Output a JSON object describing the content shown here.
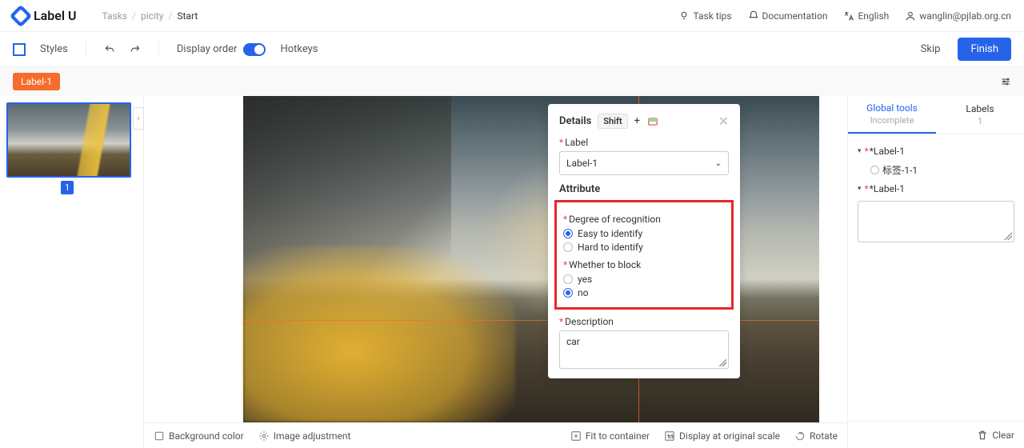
{
  "brand": "Label U",
  "breadcrumb": {
    "items": [
      "Tasks",
      "picity",
      "Start"
    ]
  },
  "header_links": {
    "tips": "Task tips",
    "docs": "Documentation",
    "lang": "English",
    "user": "wanglin@pjlab.org.cn"
  },
  "toolbar": {
    "styles": "Styles",
    "display_order": "Display order",
    "display_order_on": true,
    "hotkeys": "Hotkeys",
    "skip": "Skip",
    "finish": "Finish"
  },
  "tagbar": {
    "active_tag": "Label-1"
  },
  "thumbnails": {
    "current_index": "1"
  },
  "details": {
    "title": "Details",
    "hotkey_hint": "Shift",
    "plus": "+",
    "label_label": "Label",
    "label_value": "Label-1",
    "attribute_heading": "Attribute",
    "attr1": {
      "label": "Degree of recognition",
      "options": [
        "Easy to identify",
        "Hard to identify"
      ],
      "selected": "Easy to identify"
    },
    "attr2": {
      "label": "Whether to block",
      "options": [
        "yes",
        "no"
      ],
      "selected": "no"
    },
    "desc_label": "Description",
    "desc_value": "car"
  },
  "canvas_footer": {
    "bg_color": "Background color",
    "img_adjust": "Image adjustment",
    "fit": "Fit to container",
    "original": "Display at original scale",
    "rotate": "Rotate"
  },
  "right_panel": {
    "tab_global": "Global tools",
    "tab_global_sub": "Incomplete",
    "tab_labels": "Labels",
    "tab_labels_count": "1",
    "tree": {
      "group1": "*Label-1",
      "child1": "标签-1-1",
      "group2": "*Label-1"
    },
    "clear": "Clear"
  }
}
